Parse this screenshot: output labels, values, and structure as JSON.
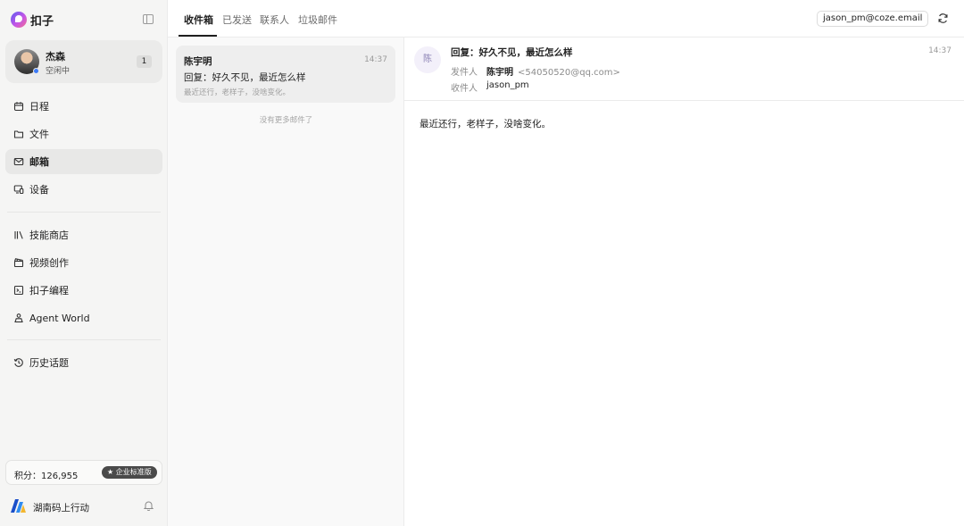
{
  "app": {
    "name": "扣子"
  },
  "user": {
    "name": "杰森",
    "status": "空闲中",
    "badge": "1"
  },
  "sidebar": {
    "main_items": [
      {
        "label": "日程",
        "icon": "calendar-icon"
      },
      {
        "label": "文件",
        "icon": "folder-icon"
      },
      {
        "label": "邮箱",
        "icon": "mail-icon",
        "active": true
      },
      {
        "label": "设备",
        "icon": "device-icon"
      }
    ],
    "tool_items": [
      {
        "label": "技能商店",
        "icon": "library-icon"
      },
      {
        "label": "视频创作",
        "icon": "clapperboard-icon"
      },
      {
        "label": "扣子编程",
        "icon": "terminal-icon"
      },
      {
        "label": "Agent World",
        "icon": "agent-icon"
      }
    ],
    "history_item": {
      "label": "历史话题",
      "icon": "history-icon"
    }
  },
  "points": {
    "text": "积分：126,955",
    "tier": "企业标准版"
  },
  "org": {
    "name": "湖南码上行动"
  },
  "tabs": [
    {
      "label": "收件箱",
      "active": true
    },
    {
      "label": "已发送"
    },
    {
      "label": "联系人"
    },
    {
      "label": "垃圾邮件"
    }
  ],
  "account": {
    "email": "jason_pm@coze.email"
  },
  "mail_list": {
    "items": [
      {
        "sender": "陈宇明",
        "time": "14:37",
        "subject": "回复：好久不见，最近怎么样",
        "preview": "最近还行，老样子，没啥变化。"
      }
    ],
    "no_more": "没有更多邮件了"
  },
  "reader": {
    "avatar_char": "陈",
    "subject": "回复：好久不见，最近怎么样",
    "time": "14:37",
    "from_label": "发件人",
    "from_name": "陈宇明",
    "from_email": "<54050520@qq.com>",
    "to_label": "收件人",
    "to_value": "jason_pm",
    "body": "最近还行，老样子，没啥变化。"
  },
  "colors": {
    "accent": "#3d7bf7",
    "active_bg": "#e8e8e7",
    "sidebar_bg": "#f5f5f4"
  }
}
